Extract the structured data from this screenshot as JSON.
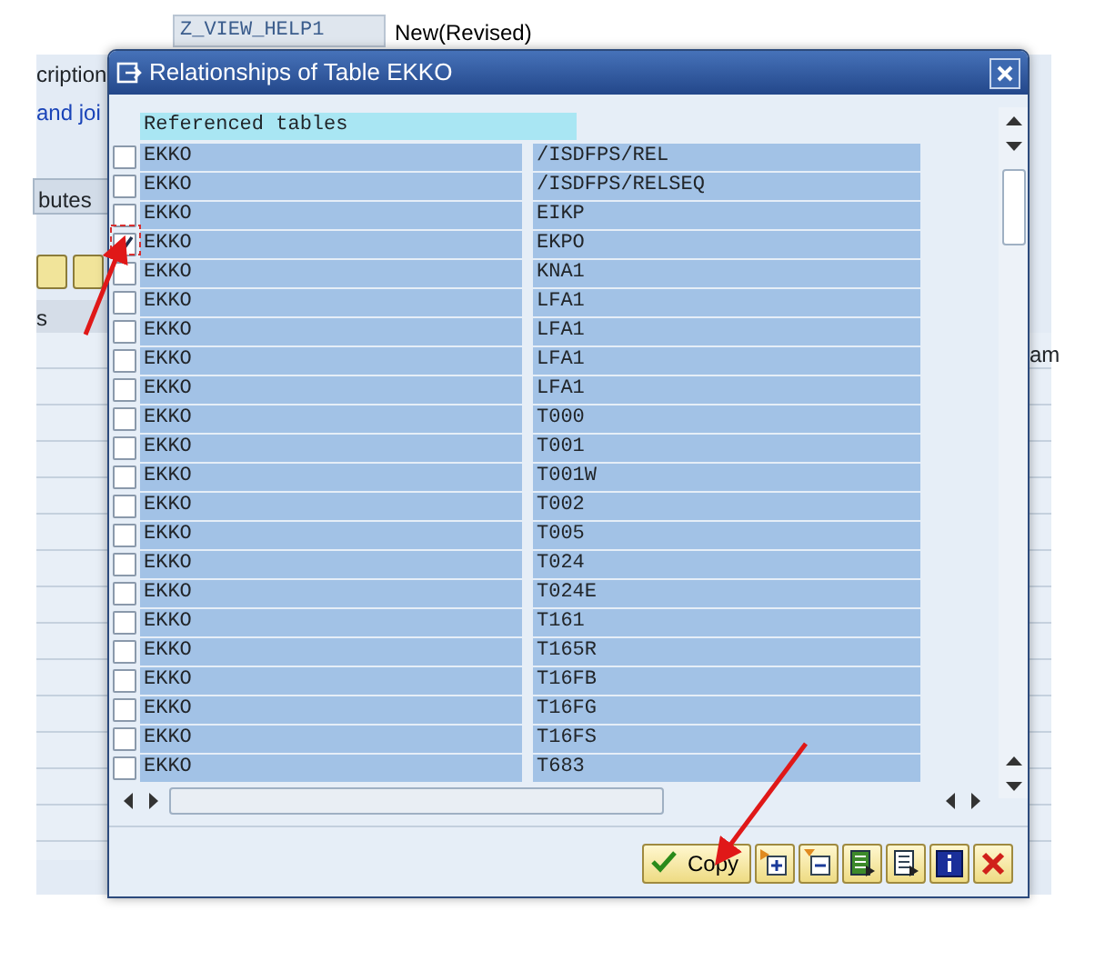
{
  "background": {
    "field_value": "Z_VIEW_HELP1",
    "status": "New(Revised)",
    "label": "cription",
    "link": "and joi",
    "tab": "butes",
    "column_header": "s",
    "right_text": "am"
  },
  "dialog": {
    "title": "Relationships of Table EKKO",
    "header": "Referenced tables",
    "rows": [
      {
        "table": "EKKO",
        "related": "/ISDFPS/REL",
        "checked": false
      },
      {
        "table": "EKKO",
        "related": "/ISDFPS/RELSEQ",
        "checked": false
      },
      {
        "table": "EKKO",
        "related": "EIKP",
        "checked": false
      },
      {
        "table": "EKKO",
        "related": "EKPO",
        "checked": true
      },
      {
        "table": "EKKO",
        "related": "KNA1",
        "checked": false
      },
      {
        "table": "EKKO",
        "related": "LFA1",
        "checked": false
      },
      {
        "table": "EKKO",
        "related": "LFA1",
        "checked": false
      },
      {
        "table": "EKKO",
        "related": "LFA1",
        "checked": false
      },
      {
        "table": "EKKO",
        "related": "LFA1",
        "checked": false
      },
      {
        "table": "EKKO",
        "related": "T000",
        "checked": false
      },
      {
        "table": "EKKO",
        "related": "T001",
        "checked": false
      },
      {
        "table": "EKKO",
        "related": "T001W",
        "checked": false
      },
      {
        "table": "EKKO",
        "related": "T002",
        "checked": false
      },
      {
        "table": "EKKO",
        "related": "T005",
        "checked": false
      },
      {
        "table": "EKKO",
        "related": "T024",
        "checked": false
      },
      {
        "table": "EKKO",
        "related": "T024E",
        "checked": false
      },
      {
        "table": "EKKO",
        "related": "T161",
        "checked": false
      },
      {
        "table": "EKKO",
        "related": "T165R",
        "checked": false
      },
      {
        "table": "EKKO",
        "related": "T16FB",
        "checked": false
      },
      {
        "table": "EKKO",
        "related": "T16FG",
        "checked": false
      },
      {
        "table": "EKKO",
        "related": "T16FS",
        "checked": false
      },
      {
        "table": "EKKO",
        "related": "T683",
        "checked": false
      }
    ],
    "buttons": [
      {
        "kind": "copy",
        "label": "Copy"
      },
      {
        "kind": "insert"
      },
      {
        "kind": "remove"
      },
      {
        "kind": "list"
      },
      {
        "kind": "document"
      },
      {
        "kind": "info"
      },
      {
        "kind": "cancel"
      }
    ]
  }
}
